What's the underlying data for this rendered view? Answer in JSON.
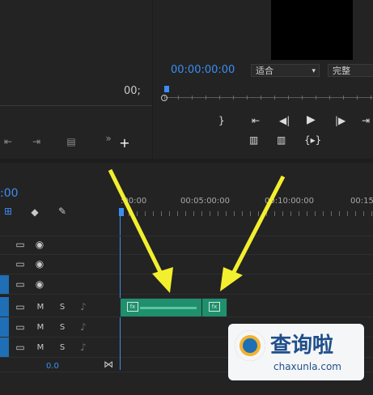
{
  "source_monitor": {
    "timecode": "00;",
    "icons": [
      "skip-icon",
      "step-forward-icon",
      "insert-icon",
      "more-icon",
      "add-icon"
    ]
  },
  "program_monitor": {
    "timecode": "00:00:00:00",
    "fit_select": "适合",
    "quality_select": "完整",
    "controls": [
      "mark-in-icon",
      "go-to-in-icon",
      "step-back-icon",
      "play-icon",
      "step-forward-icon",
      "go-to-out-icon"
    ],
    "bottom_controls": [
      "lift-icon",
      "extract-icon",
      "export-frame-icon"
    ]
  },
  "timeline": {
    "timecode": ":00",
    "ruler": [
      ":00:00",
      "00:05:00:00",
      "00:10:00:00",
      "00:15"
    ],
    "footer_value": "0.0",
    "tools": [
      "snap-icon",
      "marker-icon",
      "wrench-icon"
    ],
    "video_tracks": [
      {
        "toggle_icon": "film-toggle-icon",
        "eye_icon": "eye-icon"
      },
      {
        "toggle_icon": "film-toggle-icon",
        "eye_icon": "eye-icon"
      },
      {
        "toggle_icon": "film-toggle-icon",
        "eye_icon": "eye-icon"
      }
    ],
    "audio_tracks": [
      {
        "m": "M",
        "s": "S",
        "mic": "mic-icon"
      },
      {
        "m": "M",
        "s": "S",
        "mic": "mic-icon"
      },
      {
        "m": "M",
        "s": "S",
        "mic": "mic-icon"
      }
    ],
    "clips": [
      {
        "label": "fx"
      },
      {
        "label": "fx"
      }
    ]
  },
  "watermark": {
    "title": "查询啦",
    "url": "chaxunla.com"
  },
  "colors": {
    "accent": "#3b8ef2",
    "clip": "#1f8f6e",
    "arrow": "#f2ef2e"
  }
}
